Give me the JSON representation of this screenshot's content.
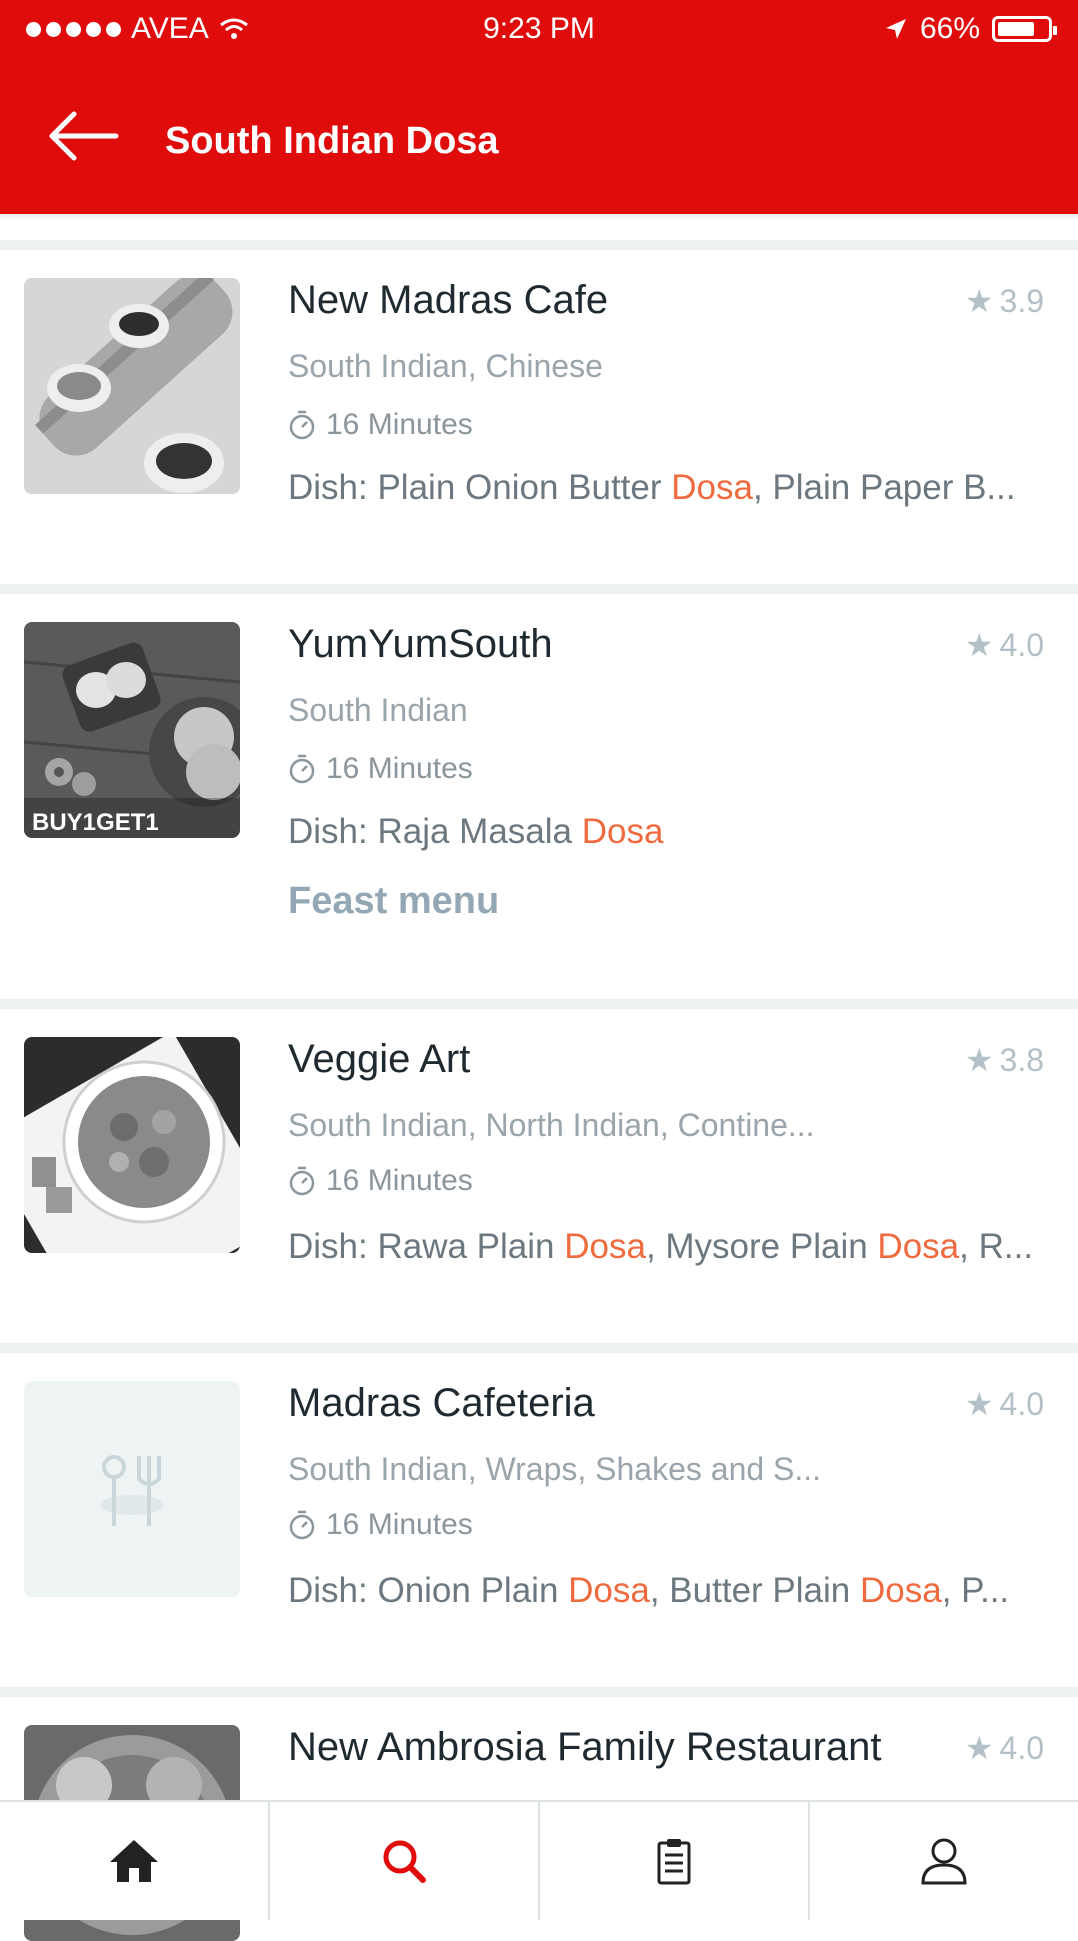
{
  "status_bar": {
    "carrier": "AVEA",
    "time": "9:23 PM",
    "battery": "66%",
    "battery_level": 0.66
  },
  "header": {
    "title": "South Indian Dosa"
  },
  "restaurants": [
    {
      "name": "New Madras Cafe",
      "rating": "3.9",
      "cuisine": "South Indian, Chinese",
      "time": "16 Minutes",
      "dish": [
        {
          "t": "Dish: Plain Onion Butter "
        },
        {
          "t": "Dosa",
          "hl": true
        },
        {
          "t": ", Plain Paper B..."
        }
      ]
    },
    {
      "name": "YumYumSouth",
      "rating": "4.0",
      "cuisine": "South Indian",
      "time": "16 Minutes",
      "badge": "BUY1GET1",
      "dish": [
        {
          "t": "Dish: Raja Masala "
        },
        {
          "t": "Dosa",
          "hl": true
        }
      ],
      "feast": "Feast menu"
    },
    {
      "name": "Veggie Art",
      "rating": "3.8",
      "cuisine": "South Indian, North Indian, Contine...",
      "time": "16 Minutes",
      "dish": [
        {
          "t": "Dish: Rawa Plain "
        },
        {
          "t": "Dosa",
          "hl": true
        },
        {
          "t": ", Mysore Plain "
        },
        {
          "t": "Dosa",
          "hl": true
        },
        {
          "t": ", R..."
        }
      ]
    },
    {
      "name": "Madras Cafeteria",
      "rating": "4.0",
      "cuisine": "South Indian, Wraps, Shakes and S...",
      "time": "16 Minutes",
      "dish": [
        {
          "t": "Dish: Onion Plain "
        },
        {
          "t": "Dosa",
          "hl": true
        },
        {
          "t": ", Butter Plain "
        },
        {
          "t": "Dosa",
          "hl": true
        },
        {
          "t": ", P..."
        }
      ]
    },
    {
      "name": "New Ambrosia Family Restaurant",
      "rating": "4.0"
    }
  ],
  "bottom_nav": [
    {
      "icon": "home-icon"
    },
    {
      "icon": "search-icon",
      "active": true
    },
    {
      "icon": "orders-icon"
    },
    {
      "icon": "profile-icon"
    }
  ],
  "colors": {
    "brand": "#e00b0b",
    "highlight": "#f06a3f",
    "rating": "#b4c0c7"
  }
}
